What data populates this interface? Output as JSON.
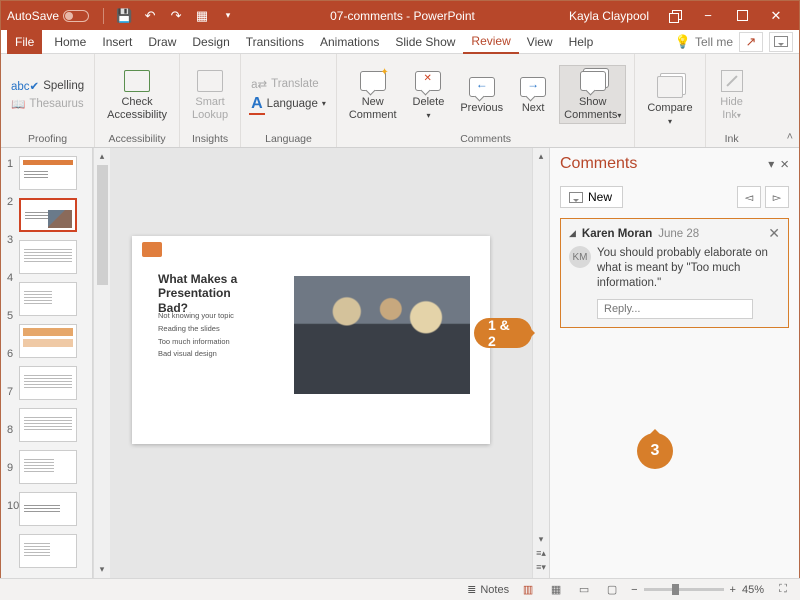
{
  "titlebar": {
    "autosave": "AutoSave",
    "doc_title": "07-comments - PowerPoint",
    "user": "Kayla Claypool"
  },
  "tabs": {
    "file": "File",
    "home": "Home",
    "insert": "Insert",
    "draw": "Draw",
    "design": "Design",
    "transitions": "Transitions",
    "animations": "Animations",
    "slideshow": "Slide Show",
    "review": "Review",
    "view": "View",
    "help": "Help",
    "tellme": "Tell me"
  },
  "ribbon": {
    "proofing": {
      "spelling": "Spelling",
      "thesaurus": "Thesaurus",
      "label": "Proofing"
    },
    "accessibility": {
      "btn": "Check\nAccessibility",
      "label": "Accessibility"
    },
    "insights": {
      "btn": "Smart\nLookup",
      "label": "Insights"
    },
    "language": {
      "translate": "Translate",
      "language": "Language",
      "label": "Language"
    },
    "comments": {
      "new": "New\nComment",
      "delete": "Delete",
      "prev": "Previous",
      "next": "Next",
      "show": "Show\nComments",
      "label": "Comments"
    },
    "compare": {
      "compare": "Compare",
      "label": ""
    },
    "ink": {
      "hide": "Hide\nInk",
      "label": "Ink"
    }
  },
  "thumbs": {
    "nums": [
      "1",
      "2",
      "3",
      "4",
      "5",
      "6",
      "7",
      "8",
      "9",
      "10"
    ]
  },
  "slide": {
    "title": "What Makes a Presentation Bad?",
    "bullets": [
      "Not knowing your topic",
      "Reading the slides",
      "Too much information",
      "Bad visual design"
    ]
  },
  "callouts": {
    "one_two": "1 & 2",
    "three": "3"
  },
  "comments_pane": {
    "title": "Comments",
    "new": "New",
    "author": "Karen Moran",
    "date": "June 28",
    "initials": "KM",
    "text": "You should probably elaborate on what is meant by \"Too much information.\"",
    "reply_ph": "Reply..."
  },
  "status": {
    "notes": "Notes",
    "zoom": "45%"
  }
}
